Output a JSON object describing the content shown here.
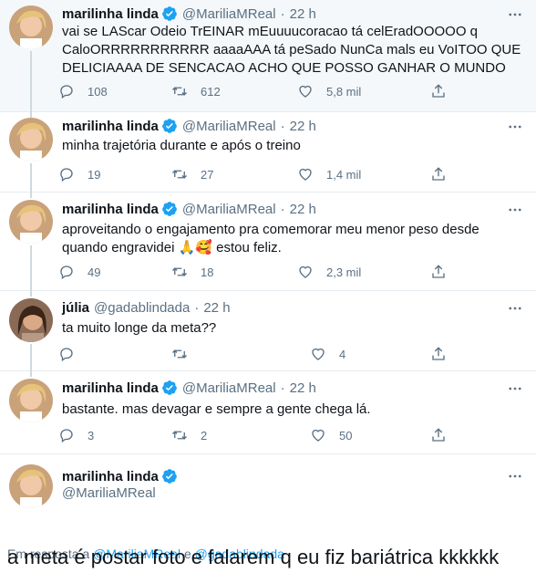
{
  "tweets": [
    {
      "name": "marilinha linda",
      "handle": "@MariliaMReal",
      "time": "22 h",
      "lines": [
        "vai se LAScar Odeio TrEINAR mEuuuucoracao tá celEradOOOOO q",
        "CaloORRRRRRRRRRR aaaaAAA tá peSado NunCa mals eu VoITOO QUE",
        "DELICIAAAA DE SENCACAO ACHO QUE POSSO GANHAR O MUNDO"
      ],
      "replies": "108",
      "retweets": "612",
      "likes": "5,8 mil"
    },
    {
      "name": "marilinha linda",
      "handle": "@MariliaMReal",
      "time": "22 h",
      "lines": [
        "minha trajetória durante e após o treino"
      ],
      "replies": "19",
      "retweets": "27",
      "likes": "1,4 mil"
    },
    {
      "name": "marilinha linda",
      "handle": "@MariliaMReal",
      "time": "22 h",
      "lines": [
        "aproveitando o engajamento pra comemorar meu menor peso desde",
        "quando engravidei 🙏🥰 estou feliz."
      ],
      "replies": "49",
      "retweets": "18",
      "likes": "2,3 mil"
    },
    {
      "name": "júlia",
      "handle": "@gadablindada",
      "time": "22 h",
      "lines": [
        "ta muito longe da meta??"
      ],
      "replies": "",
      "retweets": "",
      "likes": "4"
    },
    {
      "name": "marilinha linda",
      "handle": "@MariliaMReal",
      "time": "22 h",
      "lines": [
        "bastante. mas devagar e sempre a gente chega lá."
      ],
      "replies": "3",
      "retweets": "2",
      "likes": "50"
    }
  ],
  "main_tweet": {
    "name": "marilinha linda",
    "handle": "@MariliaMReal",
    "reply_prefix": "Em resposta a",
    "reply_handle_1": "@MariliaMReal",
    "reply_conj": "e",
    "reply_handle_2": "@gadablindada",
    "text": "a meta é postar foto e falarem q eu fiz bariátrica kkkkkk"
  },
  "icons": {
    "verified": "verified-badge-icon",
    "more": "more-icon",
    "reply": "reply-icon",
    "retweet": "retweet-icon",
    "like": "heart-icon",
    "share": "share-icon"
  },
  "colors": {
    "accent": "#1da1f2",
    "secondary_text": "#5b7083",
    "highlight_bg": "#f5f8fa"
  }
}
